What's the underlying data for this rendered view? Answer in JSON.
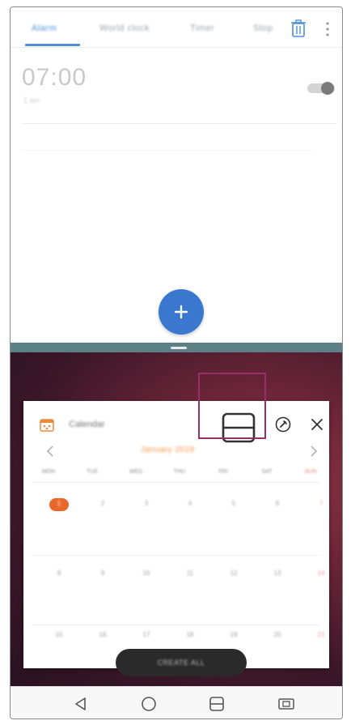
{
  "clock_app": {
    "tabs": [
      {
        "label": "Alarm"
      },
      {
        "label": "World clock"
      },
      {
        "label": "Timer"
      },
      {
        "label": "Stop"
      }
    ],
    "alarm": {
      "time": "07:00",
      "subtitle": "1 am"
    },
    "accent": "#4a8fd8"
  },
  "calendar_popup": {
    "title": "Calendar",
    "month_label": "January 2019",
    "weekdays": [
      "MON",
      "TUE",
      "WED",
      "THU",
      "FRI",
      "SAT",
      "SUN"
    ],
    "weeks": [
      [
        "1",
        "2",
        "3",
        "4",
        "5",
        "6",
        "7"
      ],
      [
        "8",
        "9",
        "10",
        "11",
        "12",
        "13",
        "14"
      ],
      [
        "15",
        "16",
        "17",
        "18",
        "19",
        "20",
        "21"
      ]
    ],
    "bottom_button": "CREATE ALL",
    "today_color": "#e8672b",
    "highlight_color": "#9a2e68"
  },
  "nav_bar": {
    "items": [
      "back-icon",
      "home-icon",
      "split-screen-icon",
      "dual-window-icon"
    ]
  }
}
